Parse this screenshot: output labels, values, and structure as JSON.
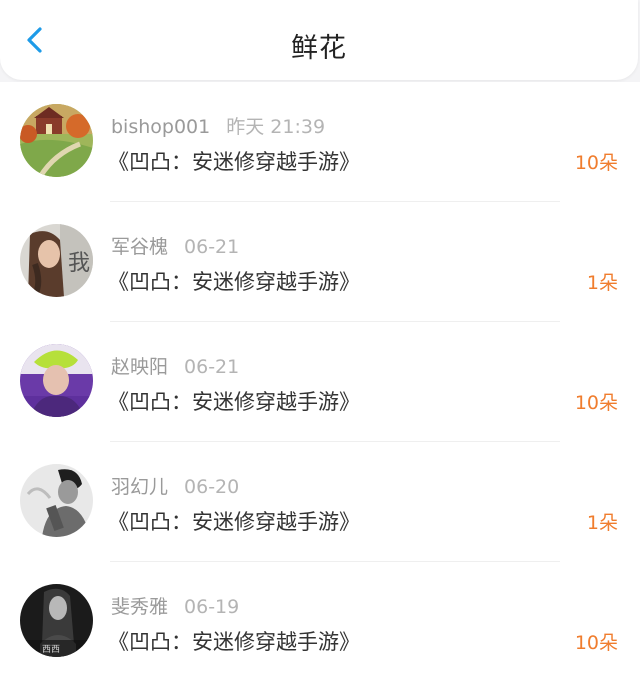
{
  "header": {
    "title": "鲜花",
    "back_icon": "chevron-left-icon",
    "accent_color": "#1e9be8"
  },
  "records": [
    {
      "username": "bishop001",
      "time": "昨天 21:39",
      "game_title": "《凹凸：安迷修穿越手游》",
      "flower_count": "10朵"
    },
    {
      "username": "军谷槐",
      "time": "06-21",
      "game_title": "《凹凸：安迷修穿越手游》",
      "flower_count": "1朵"
    },
    {
      "username": "赵映阳",
      "time": "06-21",
      "game_title": "《凹凸：安迷修穿越手游》",
      "flower_count": "10朵"
    },
    {
      "username": "羽幻儿",
      "time": "06-20",
      "game_title": "《凹凸：安迷修穿越手游》",
      "flower_count": "1朵"
    },
    {
      "username": "斐秀雅",
      "time": "06-19",
      "game_title": "《凹凸：安迷修穿越手游》",
      "flower_count": "10朵"
    }
  ],
  "colors": {
    "count": "#f07d2e",
    "name": "#9a9a9a",
    "text": "#333333"
  }
}
